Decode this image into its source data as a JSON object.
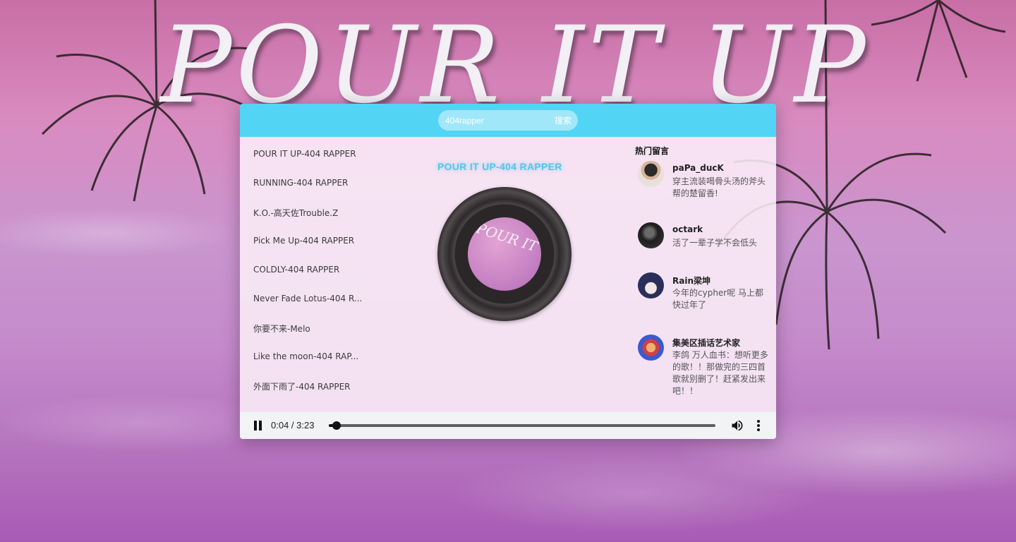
{
  "background": {
    "title_text": "POUR IT UP"
  },
  "search": {
    "value": "404rapper",
    "button_label": "搜索"
  },
  "playlist": [
    "POUR IT UP-404 RAPPER",
    "RUNNING-404 RAPPER",
    "K.O.-高天佐Trouble.Z",
    "Pick Me Up-404 RAPPER",
    "COLDLY-404 RAPPER",
    "Never Fade Lotus-404 R...",
    "你要不来-Melo",
    "Like the moon-404 RAP...",
    "外面下雨了-404 RAPPER",
    "..."
  ],
  "now_playing": {
    "title": "POUR IT UP-404 RAPPER",
    "disc_label_text": "POUR IT UP"
  },
  "comments": {
    "title": "热门留言",
    "items": [
      {
        "name": "paPa_ducK",
        "text": "穿主流装喝骨头汤的斧头帮的楚留香!"
      },
      {
        "name": "octark",
        "text": "活了一辈子学不会低头"
      },
      {
        "name": "Rain梁坤",
        "text": "今年的cypher呢 马上都快过年了"
      },
      {
        "name": "集美区插话艺术家",
        "text": "李鸽 万人血书：想听更多的歌！！那做完的三四首歌就别删了！赶紧发出来吧！！"
      }
    ]
  },
  "audio": {
    "time": "0:04 / 3:23",
    "progress_fraction": 0.0207,
    "state": "playing"
  },
  "colors": {
    "accent": "#52d4f4",
    "title_glow": "#52c6ec",
    "content_bg": "#faeef8",
    "control_bar": "#f1f3f4"
  }
}
